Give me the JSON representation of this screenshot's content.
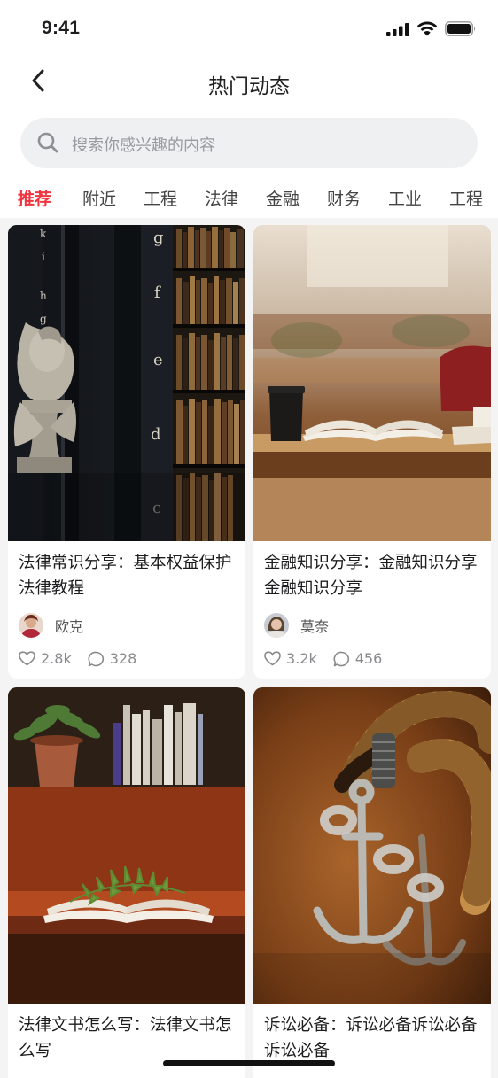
{
  "status_bar": {
    "time": "9:41"
  },
  "nav": {
    "title": "热门动态"
  },
  "search": {
    "placeholder": "搜索你感兴趣的内容"
  },
  "tabs": [
    "推荐",
    "附近",
    "工程",
    "法律",
    "金融",
    "财务",
    "工业",
    "工程"
  ],
  "active_tab": "推荐",
  "cards": [
    {
      "title": "法律常识分享：基本权益保护法律教程",
      "author": "欧克",
      "likes": "2.8k",
      "comments": "328",
      "image": "library-bookshelf-bust"
    },
    {
      "title": "金融知识分享：金融知识分享金融知识分享",
      "author": "莫奈",
      "likes": "3.2k",
      "comments": "456",
      "image": "open-book-on-desk"
    },
    {
      "title": "法律文书怎么写：法律文书怎么写",
      "image": "open-book-with-fern"
    },
    {
      "title": "诉讼必备：诉讼必备诉讼必备诉讼必备",
      "image": "anchor-and-rope"
    }
  ],
  "colors": {
    "accent": "#f0353f",
    "background": "#f4f4f5",
    "card": "#ffffff"
  }
}
